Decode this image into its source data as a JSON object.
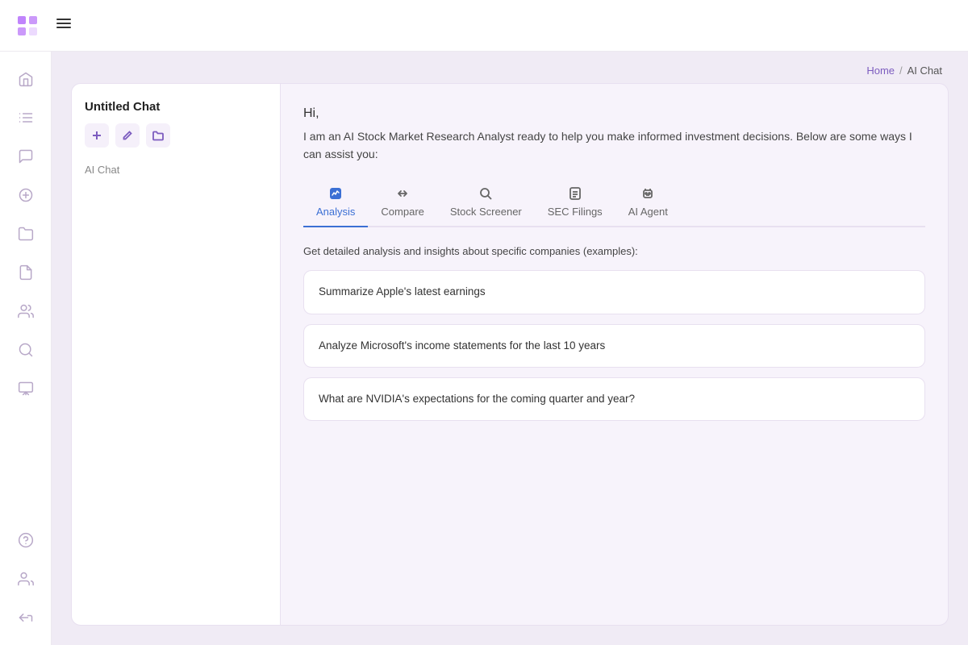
{
  "topbar": {
    "menu_icon": "☰"
  },
  "breadcrumb": {
    "home_label": "Home",
    "separator": "/",
    "current": "AI Chat"
  },
  "chat_sidebar": {
    "title": "Untitled Chat",
    "label": "AI Chat"
  },
  "chat_main": {
    "greeting": "Hi,",
    "intro": "I am an AI Stock Market Research Analyst ready to help you make informed investment decisions. Below are some ways I can assist you:",
    "tabs": [
      {
        "label": "Analysis",
        "icon": "analysis"
      },
      {
        "label": "Compare",
        "icon": "compare"
      },
      {
        "label": "Stock Screener",
        "icon": "search"
      },
      {
        "label": "SEC Filings",
        "icon": "filings"
      },
      {
        "label": "AI Agent",
        "icon": "agent"
      }
    ],
    "section_desc": "Get detailed analysis and insights about specific companies (examples):",
    "examples": [
      "Summarize Apple's latest earnings",
      "Analyze Microsoft's income statements for the last 10 years",
      "What are NVIDIA's expectations for the coming quarter and year?"
    ]
  },
  "sidebar_items": [
    {
      "icon": "home",
      "name": "home"
    },
    {
      "icon": "list",
      "name": "list"
    },
    {
      "icon": "chat",
      "name": "chat"
    },
    {
      "icon": "plus-circle",
      "name": "add"
    },
    {
      "icon": "folder",
      "name": "folder"
    },
    {
      "icon": "doc",
      "name": "document"
    },
    {
      "icon": "users",
      "name": "users"
    },
    {
      "icon": "search",
      "name": "search"
    },
    {
      "icon": "download",
      "name": "download"
    },
    {
      "icon": "question",
      "name": "help"
    },
    {
      "icon": "group",
      "name": "group"
    },
    {
      "icon": "grid",
      "name": "grid"
    }
  ]
}
